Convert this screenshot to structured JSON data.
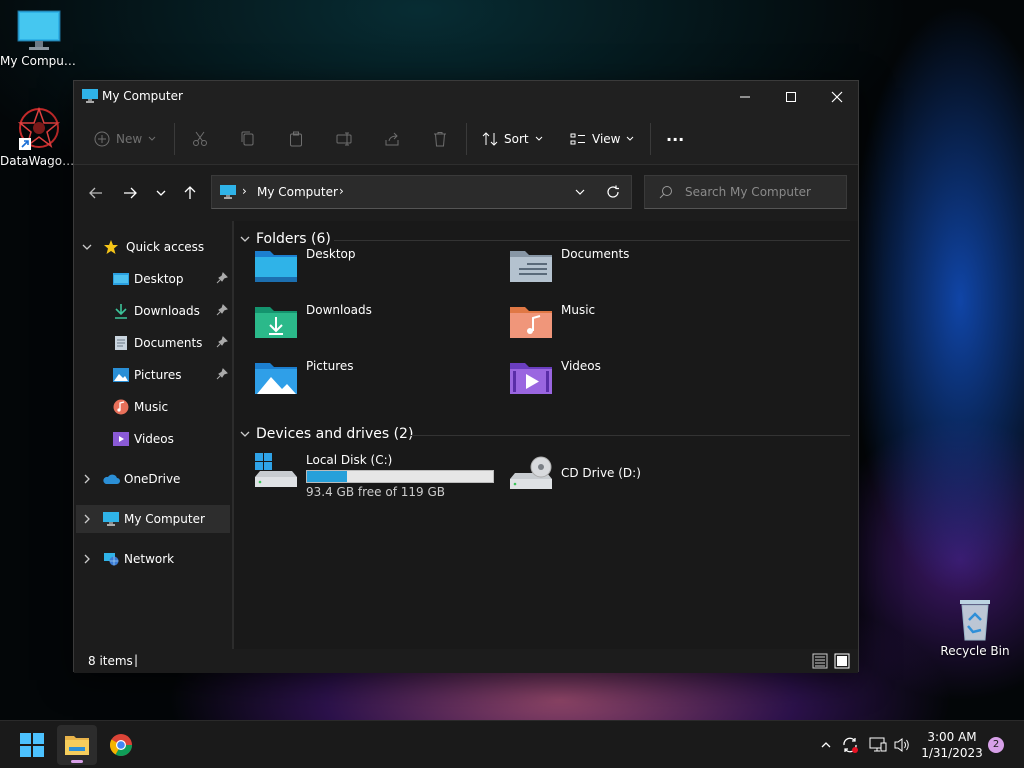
{
  "desktop": {
    "icons": [
      {
        "label": "My Computer"
      },
      {
        "label": "DataWagon..."
      },
      {
        "label": "Recycle Bin"
      }
    ]
  },
  "window": {
    "title": "My Computer",
    "toolbar": {
      "new_label": "New",
      "sort_label": "Sort",
      "view_label": "View",
      "more_label": "···"
    },
    "address": {
      "separator": "›",
      "location": "My Computer",
      "trail": "›"
    },
    "search": {
      "placeholder": "Search My Computer"
    },
    "sidebar": {
      "quick_access": "Quick access",
      "items": [
        {
          "label": "Desktop",
          "pinned": true
        },
        {
          "label": "Downloads",
          "pinned": true
        },
        {
          "label": "Documents",
          "pinned": true
        },
        {
          "label": "Pictures",
          "pinned": true
        },
        {
          "label": "Music",
          "pinned": false
        },
        {
          "label": "Videos",
          "pinned": false
        }
      ],
      "onedrive": "OneDrive",
      "my_computer": "My Computer",
      "network": "Network"
    },
    "folders": {
      "header": "Folders (6)",
      "items": [
        {
          "name": "Desktop"
        },
        {
          "name": "Documents"
        },
        {
          "name": "Downloads"
        },
        {
          "name": "Music"
        },
        {
          "name": "Pictures"
        },
        {
          "name": "Videos"
        }
      ]
    },
    "drives": {
      "header": "Devices and drives (2)",
      "items": [
        {
          "name": "Local Disk (C:)",
          "free": "93.4 GB free of 119 GB",
          "used_fraction": 0.215
        },
        {
          "name": "CD Drive (D:)"
        }
      ]
    },
    "status": {
      "items_count": "8 items",
      "cursor": "|"
    }
  },
  "taskbar": {
    "clock_time": "3:00 AM",
    "clock_date": "1/31/2023",
    "notification_count": "2"
  },
  "colors": {
    "accent": "#2b8fd6",
    "window_bg": "#1c1c1c",
    "drive_bar": "#26a0da"
  }
}
